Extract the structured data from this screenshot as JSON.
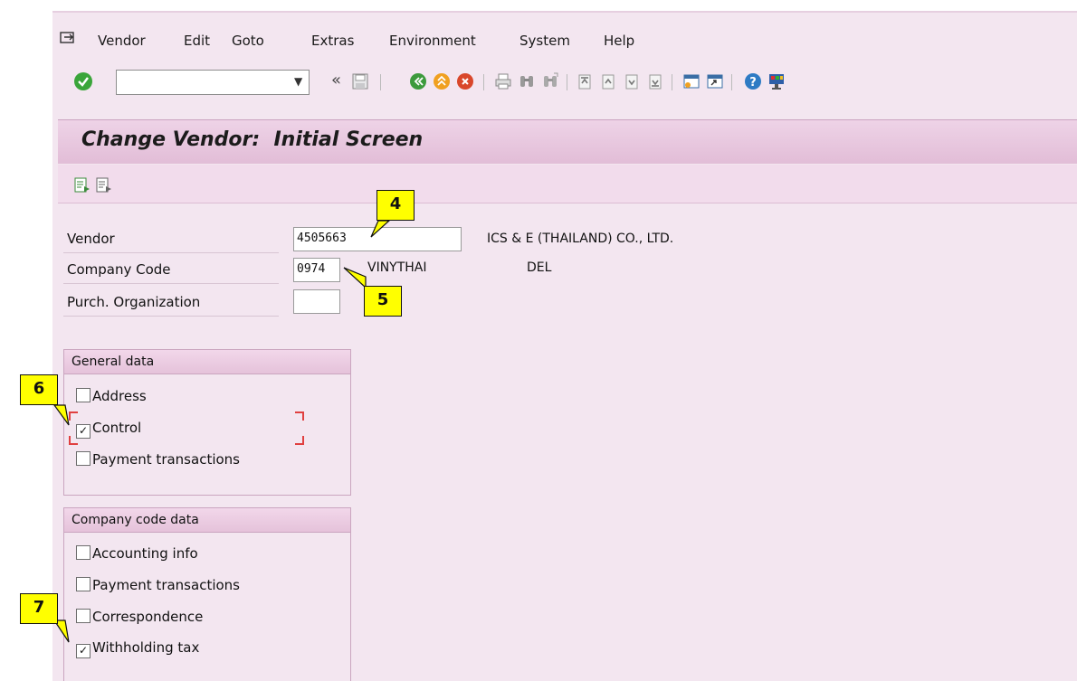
{
  "menubar": {
    "items": [
      "Vendor",
      "Edit",
      "Goto",
      "Extras",
      "Environment",
      "System",
      "Help"
    ]
  },
  "toolbar": {
    "command_field_value": "",
    "icons": [
      "enter-icon",
      "back-arrows-icon",
      "save-icon",
      "back-icon",
      "exit-icon",
      "cancel-icon",
      "print-icon",
      "find-icon",
      "find-next-icon",
      "first-page-icon",
      "prev-page-icon",
      "next-page-icon",
      "last-page-icon",
      "create-session-icon",
      "shortcut-icon",
      "help-icon",
      "customize-layout-icon"
    ],
    "colors": {
      "ok": "#3aa53a",
      "back": "#3c9a3c",
      "exit": "#f0a020",
      "cancel": "#d9472b",
      "help": "#2e7bc4"
    }
  },
  "page": {
    "title": "Change Vendor:  Initial Screen"
  },
  "fields": {
    "vendor": {
      "label": "Vendor",
      "value": "4505663",
      "description": "ICS & E (THAILAND) CO., LTD."
    },
    "company_code": {
      "label": "Company Code",
      "value": "0974",
      "name": "VINYTHAI",
      "extra": "DEL"
    },
    "purch_org": {
      "label": "Purch. Organization",
      "value": ""
    }
  },
  "general_data": {
    "title": "General data",
    "items": [
      {
        "label": "Address",
        "checked": false
      },
      {
        "label": "Control",
        "checked": true
      },
      {
        "label": "Payment transactions",
        "checked": false
      }
    ]
  },
  "company_code_data": {
    "title": "Company code data",
    "items": [
      {
        "label": "Accounting info",
        "checked": false
      },
      {
        "label": "Payment transactions",
        "checked": false
      },
      {
        "label": "Correspondence",
        "checked": false
      },
      {
        "label": "Withholding tax",
        "checked": true
      }
    ]
  },
  "callouts": [
    "4",
    "5",
    "6",
    "7"
  ],
  "colors": {
    "background": "#f3e6f0",
    "title_bar": "#e2bdd7",
    "callout": "#ffff00"
  }
}
